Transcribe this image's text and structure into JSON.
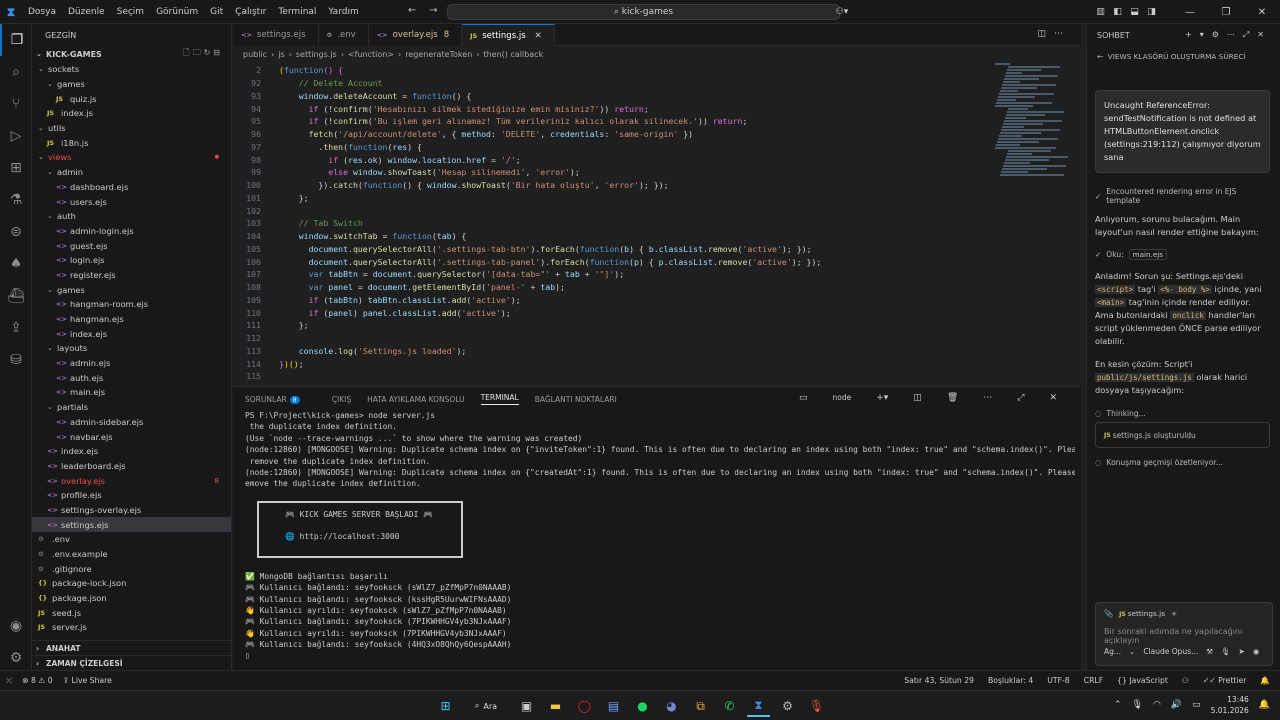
{
  "titlebar": {
    "menu": [
      "Dosya",
      "Düzenle",
      "Seçim",
      "Görünüm",
      "Git",
      "Çalıştır",
      "Terminal",
      "Yardım"
    ],
    "search": "kick-games"
  },
  "explorer": {
    "header": "GEZGİN",
    "project": "KICK-GAMES",
    "items": [
      {
        "label": "sockets",
        "depth": 1,
        "type": "folder",
        "open": true
      },
      {
        "label": "games",
        "depth": 2,
        "type": "folder",
        "open": true
      },
      {
        "label": "quiz.js",
        "depth": 3,
        "type": "js"
      },
      {
        "label": "index.js",
        "depth": 2,
        "type": "js"
      },
      {
        "label": "utils",
        "depth": 1,
        "type": "folder",
        "open": true
      },
      {
        "label": "i18n.js",
        "depth": 2,
        "type": "js"
      },
      {
        "label": "views",
        "depth": 1,
        "type": "folder",
        "open": true,
        "state": "err"
      },
      {
        "label": "admin",
        "depth": 2,
        "type": "folder",
        "open": true
      },
      {
        "label": "dashboard.ejs",
        "depth": 3,
        "type": "ejs"
      },
      {
        "label": "users.ejs",
        "depth": 3,
        "type": "ejs"
      },
      {
        "label": "auth",
        "depth": 2,
        "type": "folder",
        "open": true
      },
      {
        "label": "admin-login.ejs",
        "depth": 3,
        "type": "ejs"
      },
      {
        "label": "guest.ejs",
        "depth": 3,
        "type": "ejs"
      },
      {
        "label": "login.ejs",
        "depth": 3,
        "type": "ejs"
      },
      {
        "label": "register.ejs",
        "depth": 3,
        "type": "ejs"
      },
      {
        "label": "games",
        "depth": 2,
        "type": "folder",
        "open": true
      },
      {
        "label": "hangman-room.ejs",
        "depth": 3,
        "type": "ejs"
      },
      {
        "label": "hangman.ejs",
        "depth": 3,
        "type": "ejs"
      },
      {
        "label": "index.ejs",
        "depth": 3,
        "type": "ejs"
      },
      {
        "label": "layouts",
        "depth": 2,
        "type": "folder",
        "open": true
      },
      {
        "label": "admin.ejs",
        "depth": 3,
        "type": "ejs"
      },
      {
        "label": "auth.ejs",
        "depth": 3,
        "type": "ejs"
      },
      {
        "label": "main.ejs",
        "depth": 3,
        "type": "ejs"
      },
      {
        "label": "partials",
        "depth": 2,
        "type": "folder",
        "open": true
      },
      {
        "label": "admin-sidebar.ejs",
        "depth": 3,
        "type": "ejs"
      },
      {
        "label": "navbar.ejs",
        "depth": 3,
        "type": "ejs"
      },
      {
        "label": "index.ejs",
        "depth": 2,
        "type": "ejs"
      },
      {
        "label": "leaderboard.ejs",
        "depth": 2,
        "type": "ejs"
      },
      {
        "label": "overlay.ejs",
        "depth": 2,
        "type": "ejs",
        "state": "err",
        "badge": "8"
      },
      {
        "label": "profile.ejs",
        "depth": 2,
        "type": "ejs"
      },
      {
        "label": "settings-overlay.ejs",
        "depth": 2,
        "type": "ejs"
      },
      {
        "label": "settings.ejs",
        "depth": 2,
        "type": "ejs",
        "state": "sel"
      },
      {
        "label": ".env",
        "depth": 1,
        "type": "env"
      },
      {
        "label": ".env.example",
        "depth": 1,
        "type": "env"
      },
      {
        "label": ".gitignore",
        "depth": 1,
        "type": "env"
      },
      {
        "label": "package-lock.json",
        "depth": 1,
        "type": "json"
      },
      {
        "label": "package.json",
        "depth": 1,
        "type": "json"
      },
      {
        "label": "seed.js",
        "depth": 1,
        "type": "js"
      },
      {
        "label": "server.js",
        "depth": 1,
        "type": "js"
      }
    ],
    "sections": [
      "ANAHAT",
      "ZAMAN ÇİZELGESİ"
    ]
  },
  "tabs": [
    {
      "label": "settings.ejs",
      "icon": "<>"
    },
    {
      "label": ".env",
      "icon": "⚙"
    },
    {
      "label": "overlay.ejs",
      "icon": "<>",
      "count": "8",
      "mod": true
    },
    {
      "label": "settings.js",
      "icon": "JS",
      "active": true
    }
  ],
  "breadcrumb": [
    "public",
    "js",
    "settings.js",
    "<function>",
    "regenerateToken",
    "then() callback"
  ],
  "code": [
    {
      "n": "2",
      "h": "<span class=\"y\">(</span><span class=\"k\">function</span><span class=\"p\">()</span> <span class=\"p\">{</span>"
    },
    {
      "n": "92",
      "h": "    <span class=\"c\">// Delete Account</span>"
    },
    {
      "n": "93",
      "h": "    <span class=\"v\">window</span>.<span class=\"f\">deleteAccount</span> = <span class=\"k\">function</span>() {"
    },
    {
      "n": "94",
      "h": "      <span class=\"p\">if</span> (!<span class=\"f\">confirm</span>(<span class=\"s\">'Hesabınızı silmek istediğinize emin misiniz?'</span>)) <span class=\"p\">return</span>;"
    },
    {
      "n": "95",
      "h": "      <span class=\"p\">if</span> (!<span class=\"f\">confirm</span>(<span class=\"s\">'Bu işlem geri alınamaz! Tüm verileriniz kalıcı olarak silinecek.'</span>)) <span class=\"p\">return</span>;"
    },
    {
      "n": "96",
      "h": "      <span class=\"f\">fetch</span>(<span class=\"s\">'/api/account/delete'</span>, { <span class=\"v\">method</span>: <span class=\"s\">'DELETE'</span>, <span class=\"v\">credentials</span>: <span class=\"s\">'same-origin'</span> })"
    },
    {
      "n": "97",
      "h": "        .<span class=\"f\">then</span>(<span class=\"k\">function</span>(<span class=\"v\">res</span>) {"
    },
    {
      "n": "98",
      "h": "          <span class=\"p\">if</span> (<span class=\"v\">res</span>.<span class=\"v\">ok</span>) <span class=\"v\">window</span>.<span class=\"v\">location</span>.<span class=\"v\">href</span> = <span class=\"s\">'/'</span>;"
    },
    {
      "n": "99",
      "h": "          <span class=\"p\">else</span> <span class=\"v\">window</span>.<span class=\"f\">showToast</span>(<span class=\"s\">'Hesap silinemedi'</span>, <span class=\"s\">'error'</span>);"
    },
    {
      "n": "100",
      "h": "        }).<span class=\"f\">catch</span>(<span class=\"k\">function</span>() { <span class=\"v\">window</span>.<span class=\"f\">showToast</span>(<span class=\"s\">'Bir hata oluştu'</span>, <span class=\"s\">'error'</span>); });"
    },
    {
      "n": "101",
      "h": "    };"
    },
    {
      "n": "102",
      "h": ""
    },
    {
      "n": "103",
      "h": "    <span class=\"c\">// Tab Switch</span>"
    },
    {
      "n": "104",
      "h": "    <span class=\"v\">window</span>.<span class=\"f\">switchTab</span> = <span class=\"k\">function</span>(<span class=\"v\">tab</span>) {"
    },
    {
      "n": "105",
      "h": "      <span class=\"v\">document</span>.<span class=\"f\">querySelectorAll</span>(<span class=\"s\">'.settings-tab-btn'</span>).<span class=\"f\">forEach</span>(<span class=\"k\">function</span>(<span class=\"v\">b</span>) { <span class=\"v\">b</span>.<span class=\"v\">classList</span>.<span class=\"f\">remove</span>(<span class=\"s\">'active'</span>); });"
    },
    {
      "n": "106",
      "h": "      <span class=\"v\">document</span>.<span class=\"f\">querySelectorAll</span>(<span class=\"s\">'.settings-tab-panel'</span>).<span class=\"f\">forEach</span>(<span class=\"k\">function</span>(<span class=\"v\">p</span>) { <span class=\"v\">p</span>.<span class=\"v\">classList</span>.<span class=\"f\">remove</span>(<span class=\"s\">'active'</span>); });"
    },
    {
      "n": "107",
      "h": "      <span class=\"k\">var</span> <span class=\"v\">tabBtn</span> = <span class=\"v\">document</span>.<span class=\"f\">querySelector</span>(<span class=\"s\">'[data-tab=\"'</span> + <span class=\"v\">tab</span> + <span class=\"s\">'\"]'</span>);"
    },
    {
      "n": "108",
      "h": "      <span class=\"k\">var</span> <span class=\"v\">panel</span> = <span class=\"v\">document</span>.<span class=\"f\">getElementById</span>(<span class=\"s\">'panel-'</span> + <span class=\"v\">tab</span>);"
    },
    {
      "n": "109",
      "h": "      <span class=\"p\">if</span> (<span class=\"v\">tabBtn</span>) <span class=\"v\">tabBtn</span>.<span class=\"v\">classList</span>.<span class=\"f\">add</span>(<span class=\"s\">'active'</span>);"
    },
    {
      "n": "110",
      "h": "      <span class=\"p\">if</span> (<span class=\"v\">panel</span>) <span class=\"v\">panel</span>.<span class=\"v\">classList</span>.<span class=\"f\">add</span>(<span class=\"s\">'active'</span>);"
    },
    {
      "n": "111",
      "h": "    };"
    },
    {
      "n": "112",
      "h": ""
    },
    {
      "n": "113",
      "h": "    <span class=\"v\">console</span>.<span class=\"f\">log</span>(<span class=\"s\">'Settings.js loaded'</span>);"
    },
    {
      "n": "114",
      "h": "<span class=\"p\">}</span><span class=\"y\">)()</span>;"
    },
    {
      "n": "115",
      "h": ""
    }
  ],
  "panel": {
    "tabs": [
      "SORUNLAR",
      "ÇIKIŞ",
      "HATA AYIKLAMA KONSOLU",
      "TERMINAL",
      "BAĞLANTI NOKTALARI"
    ],
    "problems_count": "8",
    "shell": "node",
    "term_pre": [
      "PS F:\\Project\\kick-games> node server.js",
      " the duplicate index definition.",
      "(Use `node --trace-warnings ...` to show where the warning was created)",
      "(node:12860) [MONGOOSE] Warning: Duplicate schema index on {\"inviteToken\":1} found. This is often due to declaring an index using both \"index: true\" and \"schema.index()\". Please",
      " remove the duplicate index definition.",
      "(node:12860) [MONGOOSE] Warning: Duplicate schema index on {\"createdAt\":1} found. This is often due to declaring an index using both \"index: true\" and \"schema.index()\". Please r",
      "emove the duplicate index definition."
    ],
    "box": [
      "🎮 KICK GAMES SERVER BAŞLADI 🎮",
      "🌐 http://localhost:3000"
    ],
    "term_post": [
      "✅ MongoDB bağlantısı başarılı",
      "🎮 Kullanıcı bağlandı: seyfooksck (sWlZ7_pZfMpP7n0NAAAB)",
      "🎮 Kullanıcı bağlandı: seyfooksck (kssHgR5UurwWIFNsAAAD)",
      "👋 Kullanıcı ayrıldı: seyfooksck (sWlZ7_pZfMpP7n0NAAAB)",
      "🎮 Kullanıcı bağlandı: seyfooksck (7PIKWHHGV4yb3NJxAAAF)",
      "👋 Kullanıcı ayrıldı: seyfooksck (7PIKWHHGV4yb3NJxAAAF)",
      "🎮 Kullanıcı bağlandı: seyfooksck (4HQ3xO8QhQy6QespAAAH)",
      "▯"
    ]
  },
  "chat": {
    "header": "SOHBET",
    "sub": "VIEWS KLASÖRÜ OLUŞTURMA SÜRECİ",
    "user_msg": "Uncaught ReferenceError: sendTestNotification is not defined at HTMLButtonElement.onclick (settings:219:112) çalışmıyor diyorum sana",
    "step1": "Encountered rendering error in EJS template",
    "msg1": "Anlıyorum, sorunu bulacağım. Main layout'un nasıl render ettiğine bakayım:",
    "read_label": "Oku:",
    "read_file": "main.ejs",
    "msg2_a": "Anladım! Sorun şu: Settings.ejs'deki ",
    "msg2_code1": "<script>",
    "msg2_b": " tag'i ",
    "msg2_code2": "<%- body %>",
    "msg2_c": " içinde, yani ",
    "msg2_code3": "<main>",
    "msg2_d": " tag'inin içinde render ediliyor. Ama butonlardaki ",
    "msg2_code4": "onclick",
    "msg2_e": " handler'ları script yüklenmeden ÖNCE parse ediliyor olabilir.",
    "msg3_a": "En kesin çözüm: Script'i ",
    "msg3_code": "public/js/settings.js",
    "msg3_b": " olarak harici dosyaya taşıyacağım:",
    "thinking": "Thinking...",
    "created_file": "settings.js",
    "created_label": "oluşturuldu",
    "summary": "Konuşma geçmişi özetleniyor...",
    "ctx_file": "settings.js",
    "placeholder": "Bir sonraki adımda ne yapılacağını açıklayın",
    "agent": "Ag...",
    "model": "Claude Opus..."
  },
  "status": {
    "errors": "8",
    "warnings": "0",
    "live": "Live Share",
    "position": "Satır 43, Sütun 29",
    "spaces": "Boşluklar: 4",
    "encoding": "UTF-8",
    "eol": "CRLF",
    "language": "JavaScript",
    "formatter": "Prettier"
  },
  "taskbar": {
    "search": "Ara",
    "time": "13:46",
    "date": "5.01.2026"
  }
}
